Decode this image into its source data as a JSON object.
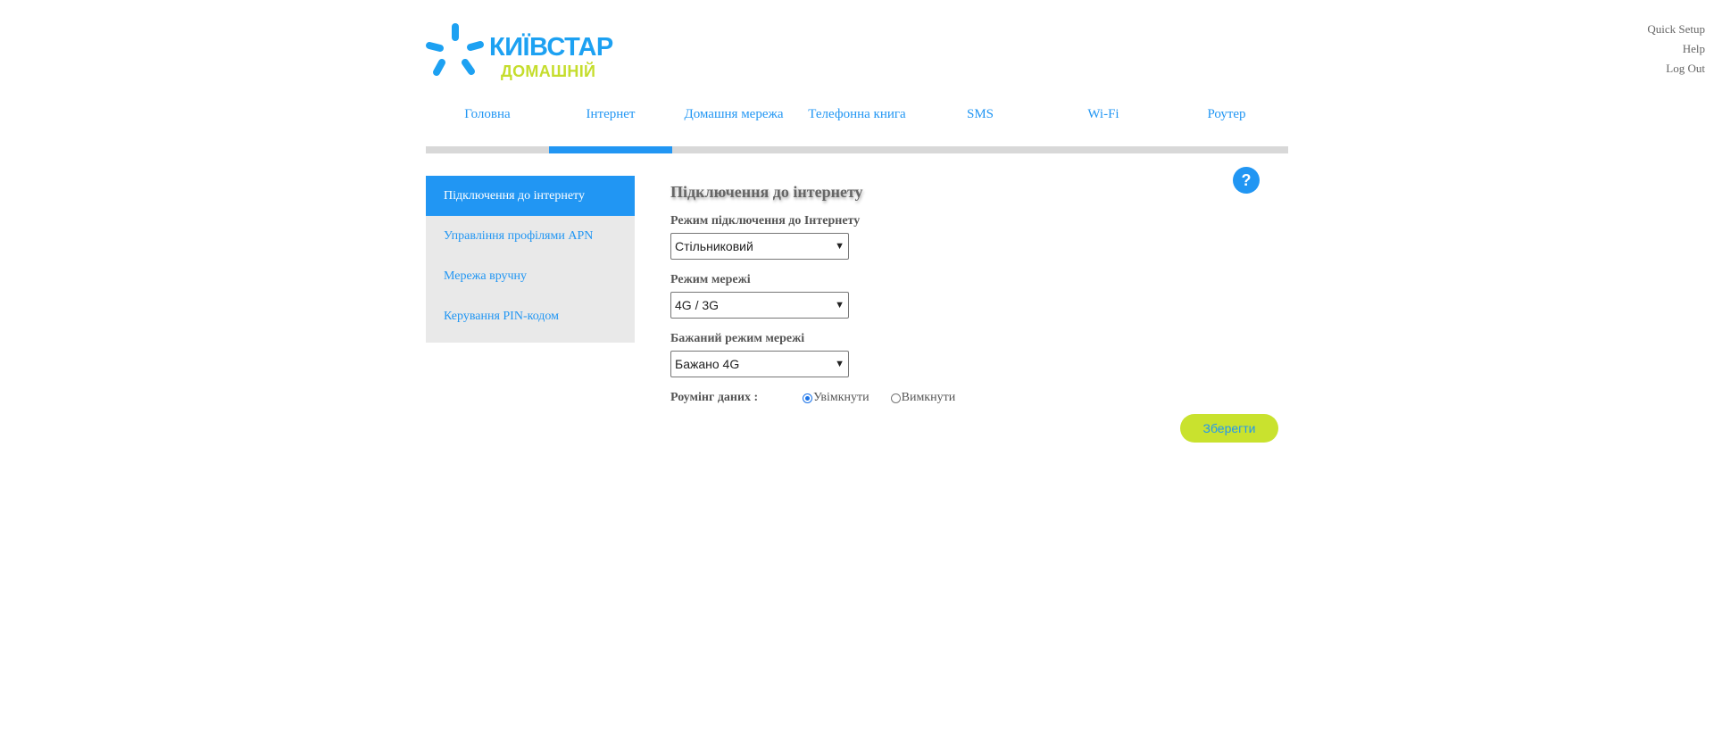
{
  "top_links": [
    "Quick Setup",
    "Help",
    "Log Out"
  ],
  "logo": {
    "brand": "КИЇВСТАР",
    "sub": "ДОМАШНІЙ",
    "icon": "star-burst-icon",
    "brand_color": "#1da1f2",
    "sub_color": "#c5dd2c"
  },
  "nav": {
    "items": [
      "Головна",
      "Інтернет",
      "Домашня мережа",
      "Телефонна книга",
      "SMS",
      "Wi-Fi",
      "Роутер"
    ],
    "active": "Інтернет"
  },
  "sidebar": {
    "items": [
      "Підключення до інтернету",
      "Управління профілями APN",
      "Мережа вручну",
      "Керування PIN-кодом"
    ],
    "active": "Підключення до інтернету"
  },
  "help": {
    "label": "?"
  },
  "content": {
    "title": "Підключення до інтернету",
    "connection_mode": {
      "label": "Режим підключення до Інтернету",
      "value": "Стільниковий"
    },
    "network_mode": {
      "label": "Режим мережі",
      "value": "4G / 3G"
    },
    "preferred_mode": {
      "label": "Бажаний режим мережі",
      "value": "Бажано 4G"
    },
    "roaming": {
      "label": "Роумінг даних :",
      "on_label": "Увімкнути",
      "off_label": "Вимкнути",
      "selected": "on"
    },
    "save_label": "Зберегти"
  },
  "colors": {
    "accent": "#2196f3",
    "save_button": "#c9e22e",
    "sidebar_bg": "#e9e9e9",
    "nav_track": "#d8d8d8"
  }
}
